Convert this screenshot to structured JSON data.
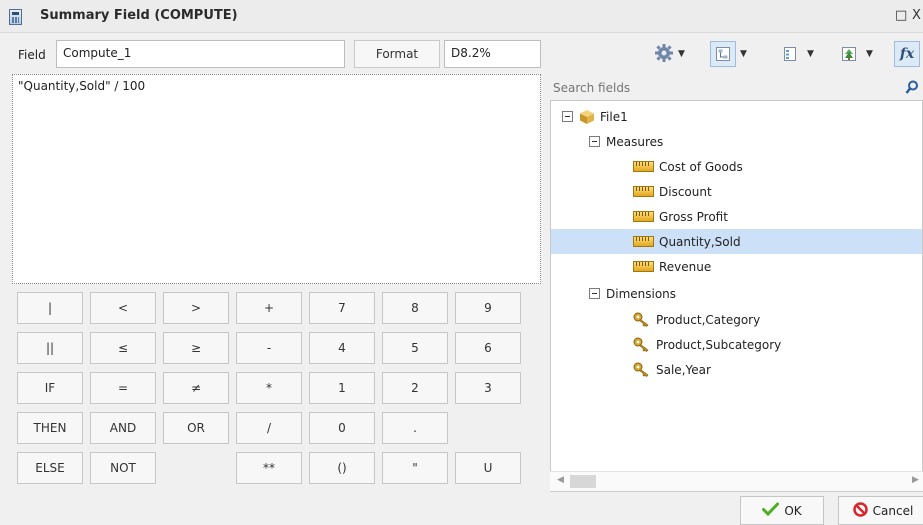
{
  "window": {
    "title": "Summary Field (COMPUTE)",
    "controls": [
      "□",
      "X"
    ]
  },
  "field": {
    "label": "Field",
    "value": "Compute_1",
    "format_button": "Format",
    "format_value": "D8.2%"
  },
  "expression": "\"Quantity,Sold\" / 100",
  "keypad": [
    [
      "|",
      "<",
      ">",
      "+",
      "7",
      "8",
      "9"
    ],
    [
      "||",
      "≤",
      "≥",
      "-",
      "4",
      "5",
      "6"
    ],
    [
      "IF",
      "=",
      "≠",
      "*",
      "1",
      "2",
      "3"
    ],
    [
      "THEN",
      "AND",
      "OR",
      "/",
      "0",
      "."
    ],
    [
      "ELSE",
      "NOT",
      "",
      "**",
      "()",
      "\"",
      "U"
    ]
  ],
  "toolbar": {
    "icons": [
      "gear-icon",
      "hierarchy-view-icon",
      "list-view-icon",
      "tree-view-icon",
      "function-fx-icon"
    ]
  },
  "search": {
    "placeholder": "Search fields"
  },
  "tree": {
    "root": "File1",
    "measures_label": "Measures",
    "measures": [
      "Cost of Goods",
      "Discount",
      "Gross Profit",
      "Quantity,Sold",
      "Revenue"
    ],
    "selected": "Quantity,Sold",
    "dimensions_label": "Dimensions",
    "dimensions": [
      "Product,Category",
      "Product,Subcategory",
      "Sale,Year"
    ]
  },
  "footer": {
    "ok": "OK",
    "cancel": "Cancel"
  },
  "colors": {
    "selection": "#cce0f7",
    "ok_check": "#4caf1f",
    "cancel_icon": "#d8262c"
  }
}
